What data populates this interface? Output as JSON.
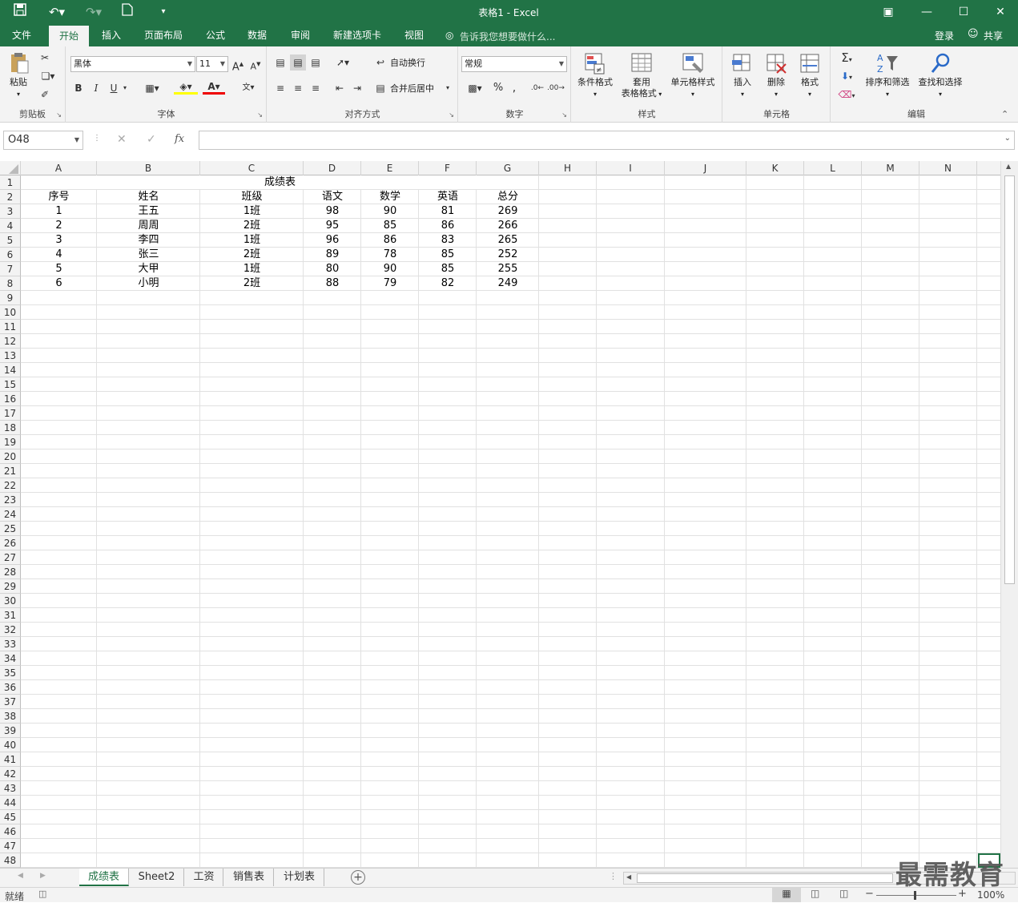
{
  "window": {
    "title": "表格1 - Excel"
  },
  "qat": {
    "save": "save-icon",
    "undo": "undo-icon",
    "redo": "redo-icon",
    "new": "new-file-icon"
  },
  "tabs": [
    "文件",
    "开始",
    "插入",
    "页面布局",
    "公式",
    "数据",
    "审阅",
    "新建选项卡",
    "视图"
  ],
  "active_tab": "开始",
  "tell_me": "告诉我您想要做什么...",
  "account": {
    "login": "登录",
    "share": "共享"
  },
  "ribbon": {
    "clipboard": {
      "label": "剪贴板",
      "paste": "粘贴"
    },
    "font": {
      "label": "字体",
      "font_name": "黑体",
      "font_size": "11",
      "bold": "B",
      "italic": "I",
      "underline": "U"
    },
    "alignment": {
      "label": "对齐方式",
      "wrap": "自动换行",
      "merge": "合并后居中"
    },
    "number": {
      "label": "数字",
      "format": "常规",
      "percent": "%",
      "comma": ","
    },
    "styles": {
      "label": "样式",
      "conditional": "条件格式",
      "table_format_1": "套用",
      "table_format_2": "表格格式",
      "cell_styles": "单元格样式"
    },
    "cells": {
      "label": "单元格",
      "insert": "插入",
      "delete": "删除",
      "format": "格式"
    },
    "editing": {
      "label": "编辑",
      "sort_filter": "排序和筛选",
      "find_select": "查找和选择"
    }
  },
  "formula_bar": {
    "name_box": "O48",
    "fx": "fx",
    "content": ""
  },
  "columns": [
    "A",
    "B",
    "C",
    "D",
    "E",
    "F",
    "G",
    "H",
    "I",
    "J",
    "K",
    "L",
    "M",
    "N"
  ],
  "rows": [
    "1",
    "2",
    "3",
    "4",
    "5",
    "6",
    "7",
    "8",
    "9",
    "10",
    "11",
    "12",
    "13",
    "14",
    "15",
    "16",
    "17",
    "18",
    "19",
    "20",
    "21",
    "22",
    "23",
    "24",
    "25",
    "26",
    "27",
    "28",
    "29",
    "30",
    "31",
    "32",
    "33",
    "34",
    "35",
    "36",
    "37",
    "38",
    "39",
    "40",
    "41",
    "42",
    "43",
    "44",
    "45",
    "46",
    "47",
    "48"
  ],
  "sheet": {
    "title": "成绩表",
    "headers": [
      "序号",
      "姓名",
      "班级",
      "语文",
      "数学",
      "英语",
      "总分"
    ],
    "data": [
      [
        "1",
        "王五",
        "1班",
        "98",
        "90",
        "81",
        "269"
      ],
      [
        "2",
        "周周",
        "2班",
        "95",
        "85",
        "86",
        "266"
      ],
      [
        "3",
        "李四",
        "1班",
        "96",
        "86",
        "83",
        "265"
      ],
      [
        "4",
        "张三",
        "2班",
        "89",
        "78",
        "85",
        "252"
      ],
      [
        "5",
        "大甲",
        "1班",
        "80",
        "90",
        "85",
        "255"
      ],
      [
        "6",
        "小明",
        "2班",
        "88",
        "79",
        "82",
        "249"
      ]
    ]
  },
  "sheet_tabs": [
    "成绩表",
    "Sheet2",
    "工资",
    "销售表",
    "计划表"
  ],
  "active_sheet": "成绩表",
  "status": {
    "ready": "就绪",
    "zoom": "100%"
  },
  "watermark": "最需教育",
  "colors": {
    "accent": "#217346"
  }
}
